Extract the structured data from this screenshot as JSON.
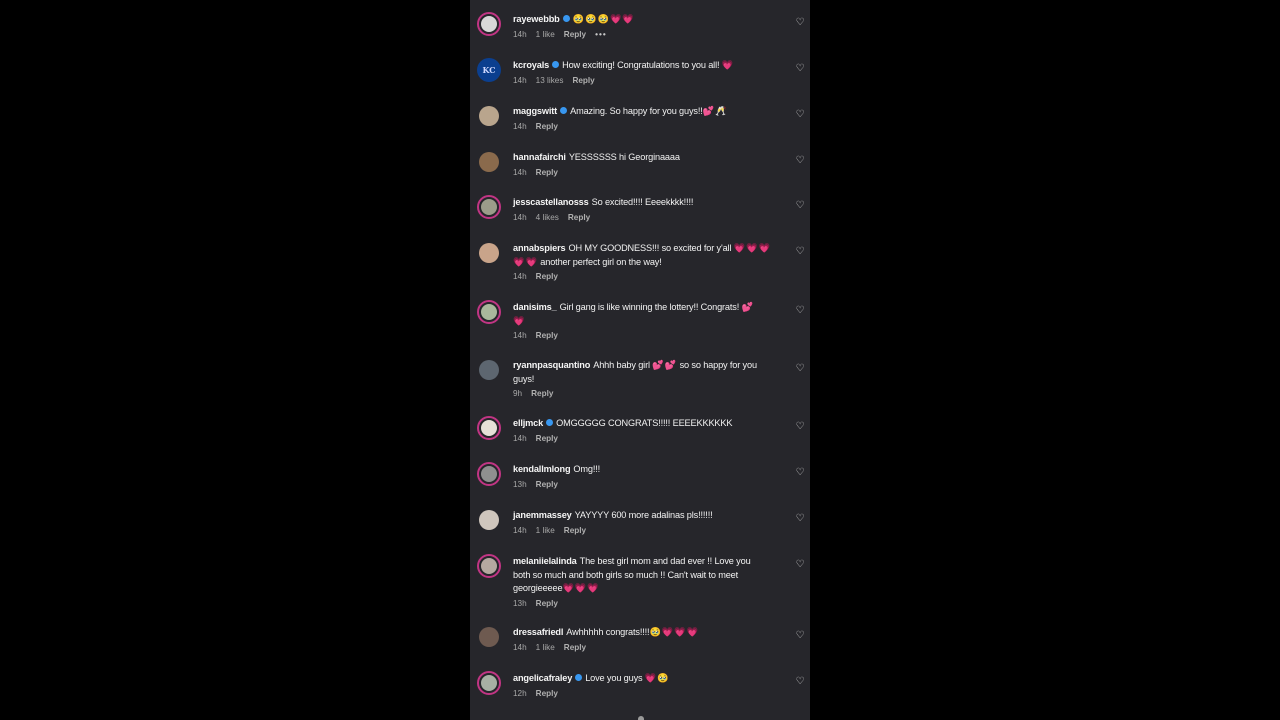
{
  "colors": {
    "panel": "#26262b",
    "verified": "#3897f0",
    "heart_emoji": "#ff4fa7",
    "story_ring": "#c13584"
  },
  "comments": [
    {
      "user": "rayewebbb",
      "verified": true,
      "text": "",
      "emoji": "🥹🥹🥹💗💗",
      "time": "14h",
      "likes": "1 like",
      "reply": "Reply",
      "more": "•••",
      "avatar_ring": true
    },
    {
      "user": "kcroyals",
      "verified": true,
      "text": "How exciting! Congratulations to you all!",
      "emoji": "💗",
      "time": "14h",
      "likes": "13 likes",
      "reply": "Reply",
      "avatar_ring": false,
      "avatar_letters": "KC"
    },
    {
      "user": "maggswitt",
      "verified": true,
      "text": "Amazing. So happy for you guys!!",
      "emoji": "💕🥂",
      "time": "14h",
      "likes": "",
      "reply": "Reply",
      "avatar_ring": false
    },
    {
      "user": "hannafairchi",
      "verified": false,
      "text": "YESSSSSS hi Georginaaaa",
      "emoji": "",
      "time": "14h",
      "likes": "",
      "reply": "Reply",
      "avatar_ring": false
    },
    {
      "user": "jesscastellanosss",
      "verified": false,
      "text": "So excited!!!! Eeeekkkk!!!!",
      "emoji": "",
      "time": "14h",
      "likes": "4 likes",
      "reply": "Reply",
      "avatar_ring": true
    },
    {
      "user": "annabspiers",
      "verified": false,
      "text": "OH MY GOODNESS!!! so excited for y'all",
      "emoji": "💗💗💗",
      "text2_emoji": "💗💗",
      "text2": "another perfect girl on the way!",
      "time": "14h",
      "likes": "",
      "reply": "Reply",
      "avatar_ring": false
    },
    {
      "user": "danisims_",
      "verified": false,
      "text": "Girl gang is like winning the lottery!! Congrats!",
      "emoji": "💕",
      "text2_emoji": "💗",
      "text2": "",
      "time": "14h",
      "likes": "",
      "reply": "Reply",
      "avatar_ring": true
    },
    {
      "user": "ryannpasquantino",
      "verified": false,
      "text": "Ahhh baby girl",
      "emoji": "💕💕",
      "text_after": "so so happy for you",
      "text2": "guys!",
      "time": "9h",
      "likes": "",
      "reply": "Reply",
      "avatar_ring": false
    },
    {
      "user": "elljmck",
      "verified": true,
      "text": "OMGGGGG CONGRATS!!!!! EEEEKKKKKK",
      "emoji": "",
      "time": "14h",
      "likes": "",
      "reply": "Reply",
      "avatar_ring": true
    },
    {
      "user": "kendallmlong",
      "verified": false,
      "text": "Omg!!!",
      "emoji": "",
      "time": "13h",
      "likes": "",
      "reply": "Reply",
      "avatar_ring": true
    },
    {
      "user": "janemmassey",
      "verified": false,
      "text": "YAYYYY 600 more adalinas pls!!!!!!",
      "emoji": "",
      "time": "14h",
      "likes": "1 like",
      "reply": "Reply",
      "avatar_ring": false
    },
    {
      "user": "melaniielalinda",
      "verified": false,
      "text": "The best girl mom and dad ever !! Love you",
      "text2": "both so much and both girls so much !! Can't wait to meet",
      "text3": "georgieeeee",
      "text3_emoji": "💗💗💗",
      "time": "13h",
      "likes": "",
      "reply": "Reply",
      "avatar_ring": true
    },
    {
      "user": "dressafriedl",
      "verified": false,
      "text": "Awhhhhh congrats!!!!",
      "emoji": "🥹💗💗💗",
      "time": "14h",
      "likes": "1 like",
      "reply": "Reply",
      "avatar_ring": false
    },
    {
      "user": "angelicafraley",
      "verified": true,
      "text": "Love you guys",
      "emoji": "💗🥹",
      "time": "12h",
      "likes": "",
      "reply": "Reply",
      "avatar_ring": true
    }
  ],
  "like_icon": "heart-outline-icon"
}
